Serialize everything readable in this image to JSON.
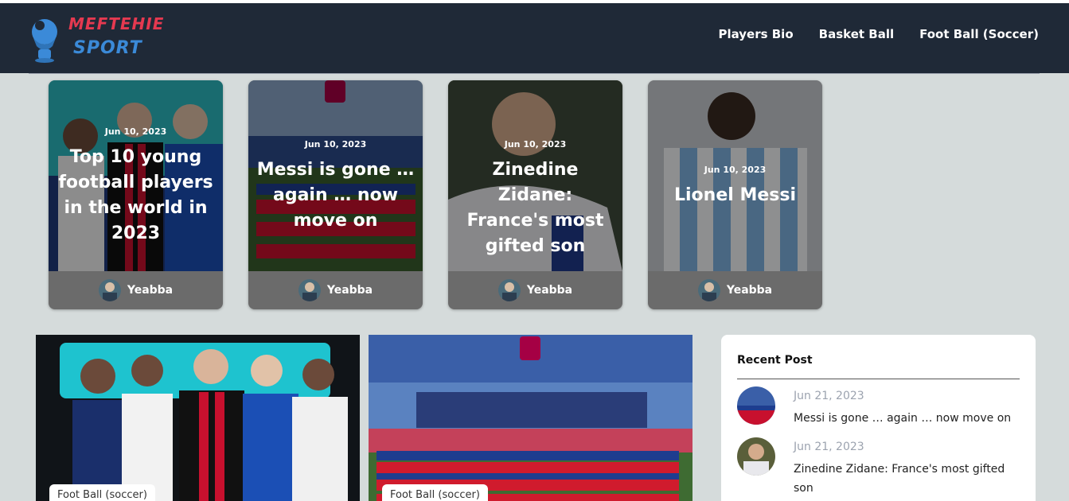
{
  "brand": {
    "line1": "MEFTEHIE",
    "line2": "SPORT"
  },
  "nav": [
    {
      "label": "Players Bio"
    },
    {
      "label": "Basket Ball"
    },
    {
      "label": "Foot Ball (Soccer)"
    }
  ],
  "featured": [
    {
      "date": "Jun 10, 2023",
      "title": "Top 10 young football players in the world in 2023",
      "author": "Yeabba"
    },
    {
      "date": "Jun 10, 2023",
      "title": "Messi is gone … again … now move on",
      "author": "Yeabba"
    },
    {
      "date": "Jun 10, 2023",
      "title": "Zinedine Zidane: France's most gifted son",
      "author": "Yeabba"
    },
    {
      "date": "Jun 10, 2023",
      "title": "Lionel Messi",
      "author": "Yeabba"
    }
  ],
  "posts": [
    {
      "tag": "Foot Ball (soccer)"
    },
    {
      "tag": "Foot Ball (soccer)"
    }
  ],
  "recent": {
    "title": "Recent Post",
    "items": [
      {
        "date": "Jun 21, 2023",
        "title": "Messi is gone … again … now move on"
      },
      {
        "date": "Jun 21, 2023",
        "title": "Zinedine Zidane: France's most gifted son"
      }
    ]
  },
  "colors": {
    "header": "#1f2937",
    "page_bg": "#d5dbdb",
    "brand_red": "#e53950",
    "brand_blue": "#3b8ad8"
  }
}
